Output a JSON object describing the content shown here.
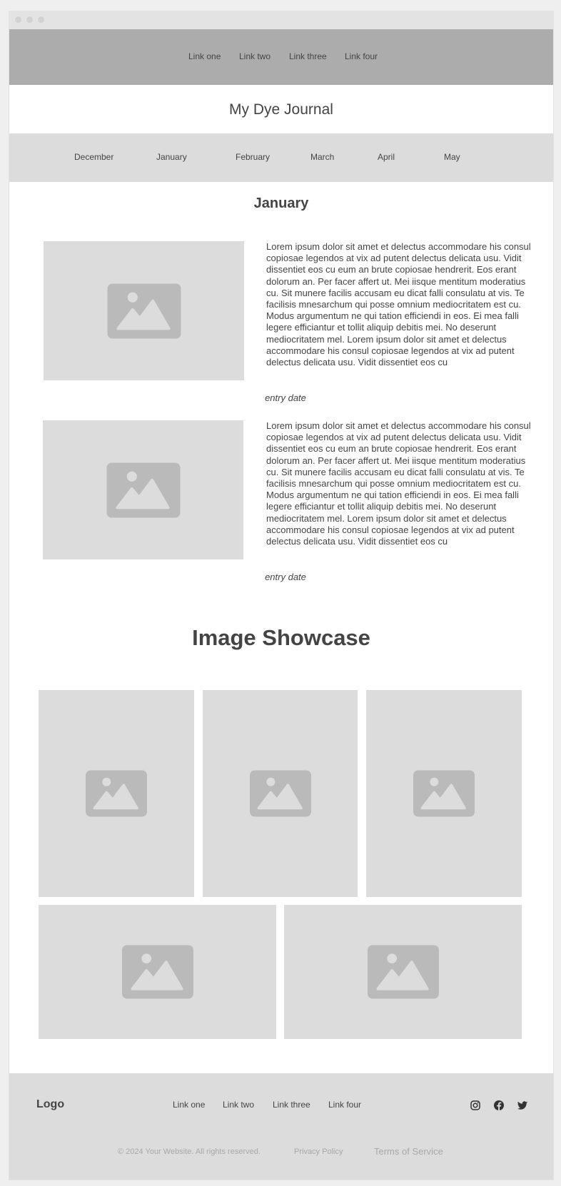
{
  "nav": {
    "links": [
      "Link one",
      "Link two",
      "Link three",
      "Link four"
    ]
  },
  "site": {
    "title": "My Dye Journal"
  },
  "months": [
    "December",
    "January",
    "February",
    "March",
    "April",
    "May"
  ],
  "journal": {
    "heading": "January",
    "entries": [
      {
        "text": "Lorem ipsum dolor sit amet et delectus accommodare his consul copiosae legendos at vix ad putent delectus delicata usu. Vidit dissentiet eos cu eum an brute copiosae hendrerit. Eos erant dolorum an. Per facer affert ut. Mei iisque mentitum moderatius cu. Sit munere facilis accusam eu dicat falli consulatu at vis. Te facilisis mnesarchum qui posse omnium mediocritatem est cu. Modus argumentum ne qui tation efficiendi in eos. Ei mea falli legere efficiantur et tollit aliquip debitis mei. No deserunt mediocritatem mel. Lorem ipsum dolor sit amet et delectus accommodare his consul copiosae legendos at vix ad putent delectus delicata usu. Vidit dissentiet eos cu",
        "date": "entry date"
      },
      {
        "text": "Lorem ipsum dolor sit amet et delectus accommodare his consul copiosae legendos at vix ad putent delectus delicata usu. Vidit dissentiet eos cu eum an brute copiosae hendrerit. Eos erant dolorum an. Per facer affert ut. Mei iisque mentitum moderatius cu. Sit munere facilis accusam eu dicat falli consulatu at vis. Te facilisis mnesarchum qui posse omnium mediocritatem est cu. Modus argumentum ne qui tation efficiendi in eos. Ei mea falli legere efficiantur et tollit aliquip debitis mei. No deserunt mediocritatem mel. Lorem ipsum dolor sit amet et delectus accommodare his consul copiosae legendos at vix ad putent delectus delicata usu. Vidit dissentiet eos cu",
        "date": "entry date"
      }
    ]
  },
  "showcase": {
    "heading": "Image Showcase"
  },
  "footer": {
    "logo": "Logo",
    "links": [
      "Link one",
      "Link two",
      "Link three",
      "Link four"
    ],
    "social_icons": [
      "instagram-icon",
      "facebook-icon",
      "twitter-icon"
    ],
    "copyright": "© 2024 Your Website. All rights reserved.",
    "privacy": "Privacy Policy",
    "terms": "Terms of Service"
  },
  "colors": {
    "topnav_bg": "#acacac",
    "band_bg": "#dcdcdc",
    "placeholder_bg": "#dcdcdc",
    "placeholder_icon": "#bababa",
    "text": "#444444"
  }
}
